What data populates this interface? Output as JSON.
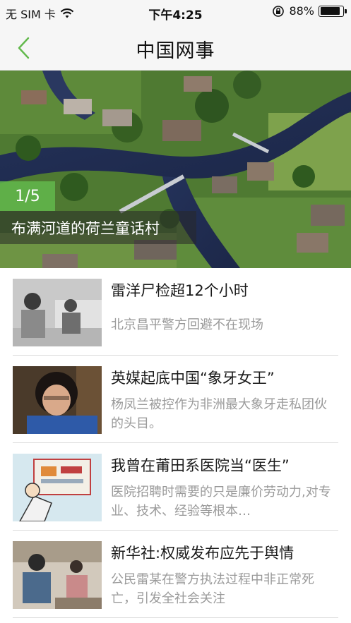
{
  "status_bar": {
    "carrier": "无 SIM 卡",
    "time": "下午4:25",
    "battery": "88%",
    "battery_level": 0.88
  },
  "nav": {
    "title": "中国网事",
    "accent_color": "#62b94c"
  },
  "banner": {
    "page_indicator": "1/5",
    "caption": "布满河道的荷兰童话村"
  },
  "news": [
    {
      "title": "雷洋尸检超12个小时",
      "summary": "北京昌平警方回避不在现场"
    },
    {
      "title": "英媒起底中国“象牙女王”",
      "summary": "杨凤兰被控作为非洲最大象牙走私团伙的头目。"
    },
    {
      "title": "我曾在莆田系医院当“医生”",
      "summary": "医院招聘时需要的只是廉价劳动力,对专业、技术、经验等根本…"
    },
    {
      "title": "新华社:权威发布应先于舆情",
      "summary": "公民雷某在警方执法过程中非正常死亡，引发全社会关注"
    }
  ]
}
